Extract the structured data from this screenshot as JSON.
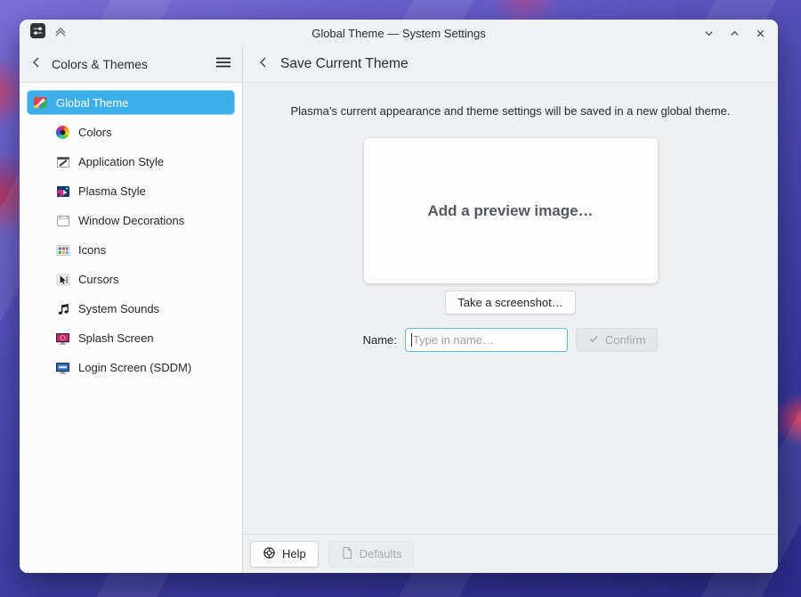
{
  "window": {
    "title": "Global Theme — System Settings"
  },
  "sidebar": {
    "title": "Colors & Themes",
    "items": [
      {
        "label": "Global Theme",
        "icon": "global-theme-icon",
        "selected": true
      },
      {
        "label": "Colors",
        "icon": "colors-icon",
        "selected": false
      },
      {
        "label": "Application Style",
        "icon": "application-style-icon",
        "selected": false
      },
      {
        "label": "Plasma Style",
        "icon": "plasma-style-icon",
        "selected": false
      },
      {
        "label": "Window Decorations",
        "icon": "window-decorations-icon",
        "selected": false
      },
      {
        "label": "Icons",
        "icon": "icons-icon",
        "selected": false
      },
      {
        "label": "Cursors",
        "icon": "cursors-icon",
        "selected": false
      },
      {
        "label": "System Sounds",
        "icon": "system-sounds-icon",
        "selected": false
      },
      {
        "label": "Splash Screen",
        "icon": "splash-screen-icon",
        "selected": false
      },
      {
        "label": "Login Screen (SDDM)",
        "icon": "login-screen-icon",
        "selected": false
      }
    ]
  },
  "main": {
    "title": "Save Current Theme",
    "description": "Plasma’s current appearance and theme settings will be saved in a new global theme.",
    "preview_placeholder": "Add a preview image…",
    "screenshot_button": "Take a screenshot…",
    "name_label": "Name:",
    "name_input": {
      "value": "",
      "placeholder": "Type in name…"
    },
    "confirm_button": "Confirm",
    "confirm_enabled": false
  },
  "footer": {
    "help_button": "Help",
    "defaults_button": "Defaults",
    "defaults_enabled": false
  },
  "icons": [
    "app-icon",
    "keep-above-icon",
    "minimize-icon",
    "maximize-icon",
    "close-icon",
    "back-icon",
    "hamburger-menu-icon",
    "help-icon",
    "defaults-document-icon",
    "check-icon"
  ],
  "colors": {
    "highlight": "#3daee9",
    "focus_border": "#5cb8ee",
    "window_bg": "#eff0f1",
    "view_bg": "#fcfcfc",
    "text": "#232629",
    "disabled_text": "#a6aaad"
  }
}
